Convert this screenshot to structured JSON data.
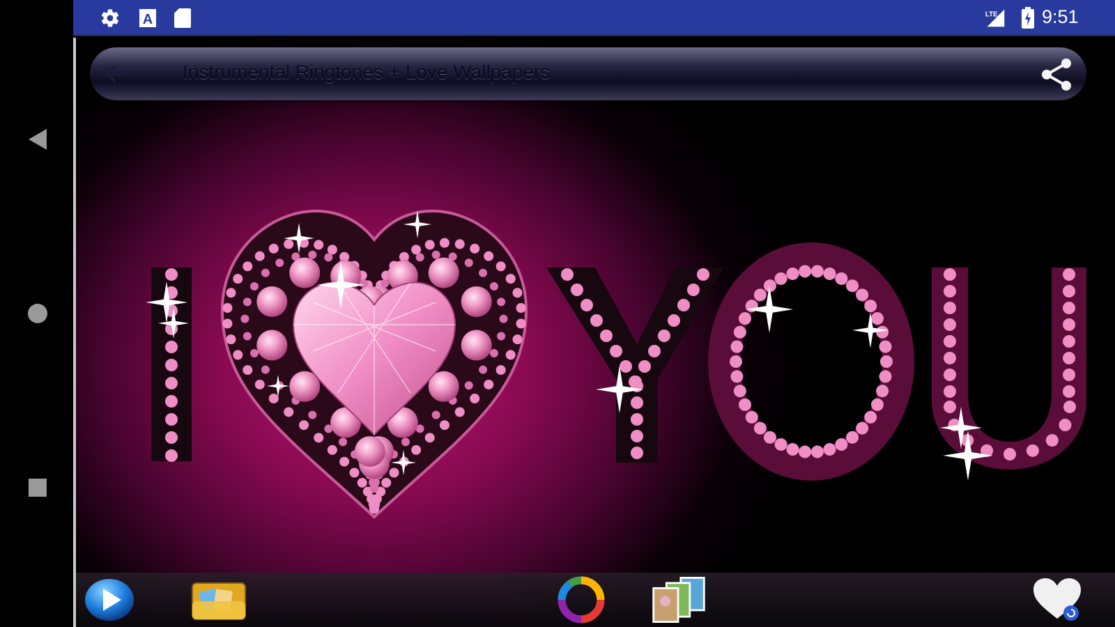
{
  "status_bar": {
    "time": "9:51",
    "network": "LTE",
    "icons": [
      "settings-icon",
      "a-box-icon",
      "sd-card-icon",
      "signal-icon",
      "battery-icon"
    ]
  },
  "nav": {
    "icons": [
      "back-triangle-icon",
      "home-circle-icon",
      "recents-square-icon"
    ]
  },
  "app_bar": {
    "title": "Instrumental Ringtones + Love Wallpapers",
    "back_icon": "back-arrow-icon",
    "share_icon": "share-icon"
  },
  "wallpaper": {
    "letters": [
      "I",
      "Y",
      "O",
      "U"
    ]
  },
  "bottom_toolbar": {
    "icons": [
      "play-icon",
      "gallery-folder-icon",
      "color-ring-icon",
      "photos-icon",
      "favorite-heart-icon"
    ]
  },
  "colors": {
    "status_bar": "#283a9e",
    "accent_pink": "#e879b8",
    "magenta": "#b4156e"
  }
}
